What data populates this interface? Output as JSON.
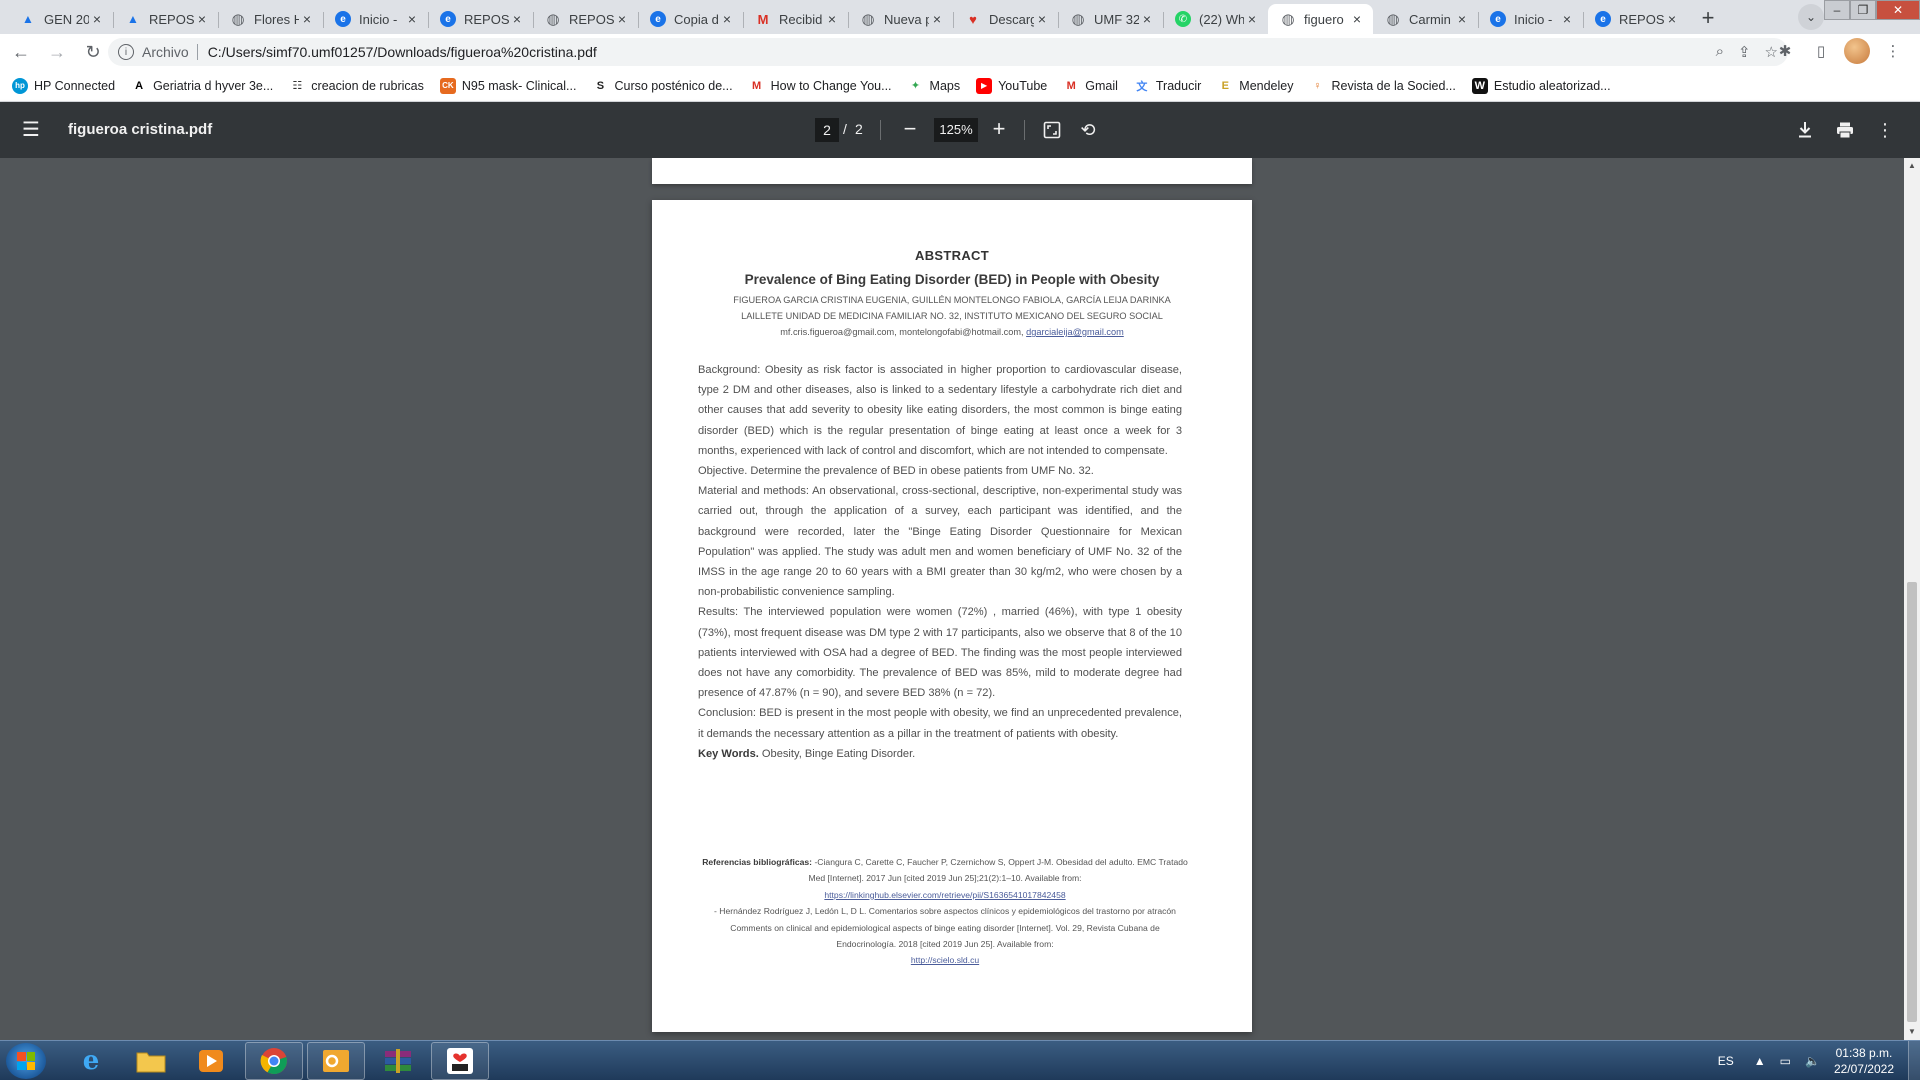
{
  "browser": {
    "tabs": [
      {
        "label": "GEN 20",
        "favicon": "drive",
        "color": "#1a73e8"
      },
      {
        "label": "REPOSI",
        "favicon": "drive",
        "color": "#1a73e8"
      },
      {
        "label": "Flores H",
        "favicon": "globe",
        "color": "#5f6368"
      },
      {
        "label": "Inicio -",
        "favicon": "edge-e",
        "color": "#1a73e8"
      },
      {
        "label": "REPOSI",
        "favicon": "edge-e",
        "color": "#1a73e8"
      },
      {
        "label": "REPOSI",
        "favicon": "globe",
        "color": "#5f6368"
      },
      {
        "label": "Copia d",
        "favicon": "edge-e",
        "color": "#1a73e8"
      },
      {
        "label": "Recibid",
        "favicon": "gmail",
        "color": "#d93025"
      },
      {
        "label": "Nueva p",
        "favicon": "globe",
        "color": "#5f6368"
      },
      {
        "label": "Descarg",
        "favicon": "heart",
        "color": "#d93025"
      },
      {
        "label": "UMF 32",
        "favicon": "globe",
        "color": "#5f6368"
      },
      {
        "label": "(22) Wh",
        "favicon": "whatsapp",
        "color": "#25d366"
      },
      {
        "label": "figuero",
        "favicon": "globe",
        "color": "#5f6368",
        "active": true
      },
      {
        "label": "Carmin",
        "favicon": "globe",
        "color": "#5f6368"
      },
      {
        "label": "Inicio -",
        "favicon": "edge-e",
        "color": "#1a73e8"
      },
      {
        "label": "REPOSI",
        "favicon": "edge-e",
        "color": "#1a73e8"
      }
    ],
    "address": {
      "chip": "Archivo",
      "url": "C:/Users/simf70.umf01257/Downloads/figueroa%20cristina.pdf"
    },
    "bookmarks": [
      {
        "label": "HP Connected",
        "icon": "hp-icon",
        "icon_color": "#0096d6"
      },
      {
        "label": "Geriatria d hyver 3e...",
        "icon": "a-icon",
        "icon_color": "#000000"
      },
      {
        "label": "creacion de rubricas",
        "icon": "rubric-icon",
        "icon_color": "#333333"
      },
      {
        "label": "N95 mask- Clinical...",
        "icon": "ck-icon",
        "icon_color": "#e66a1f"
      },
      {
        "label": "Curso posténico de...",
        "icon": "s-icon",
        "icon_color": "#222222"
      },
      {
        "label": "How to Change You...",
        "icon": "gmail-icon",
        "icon_color": "#d93025"
      },
      {
        "label": "Maps",
        "icon": "maps-icon",
        "icon_color": "#34a853"
      },
      {
        "label": "YouTube",
        "icon": "youtube-icon",
        "icon_color": "#ff0000"
      },
      {
        "label": "Gmail",
        "icon": "gmail-icon",
        "icon_color": "#d93025"
      },
      {
        "label": "Traducir",
        "icon": "translate-icon",
        "icon_color": "#4285f4"
      },
      {
        "label": "Mendeley",
        "icon": "mendeley-icon",
        "icon_color": "#c9a227"
      },
      {
        "label": "Revista de la Socied...",
        "icon": "figure-icon",
        "icon_color": "#e37a2c"
      },
      {
        "label": "Estudio aleatorizad...",
        "icon": "w-icon",
        "icon_color": "#111111"
      }
    ]
  },
  "pdf_viewer": {
    "title": "figueroa cristina.pdf",
    "current_page": "2",
    "page_separator": "/",
    "total_pages": "2",
    "zoom": "125%"
  },
  "document": {
    "heading": "ABSTRACT",
    "title": "Prevalence of Bing Eating Disorder (BED) in People with Obesity",
    "authors_line1": "FIGUEROA GARCIA CRISTINA EUGENIA, GUILLÉN MONTELONGO FABIOLA, GARCÍA LEIJA DARINKA",
    "authors_line2": "LAILLETE UNIDAD DE MEDICINA FAMILIAR NO. 32, INSTITUTO MEXICANO DEL SEGURO SOCIAL",
    "emails": "mf.cris.figueroa@gmail.com, montelongofabi@hotmail.com,",
    "email_link": "dgarcialeija@gmail.com",
    "background": "Background: Obesity as risk factor is associated in higher proportion to cardiovascular disease, type 2 DM and other diseases, also is linked to a sedentary lifestyle a carbohydrate rich diet and other causes that add severity to obesity like eating disorders, the most common is binge eating disorder (BED) which is the regular presentation of binge eating at least once a week for 3 months, experienced with lack of control and discomfort, which are not intended to compensate.",
    "objective": "Objective. Determine the prevalence of BED in obese patients from UMF No. 32.",
    "methods": "Material and methods: An observational, cross-sectional, descriptive, non-experimental study was carried out, through the application of a survey, each participant was identified, and the background were recorded, later the \"Binge Eating Disorder Questionnaire for Mexican Population\" was applied. The study was adult men and women beneficiary of UMF No. 32 of the IMSS in the age range 20 to 60 years with a BMI greater than 30 kg/m2, who were chosen by a non-probabilistic convenience sampling.",
    "results": "Results: The interviewed population were women (72%) , married (46%), with type 1 obesity (73%), most frequent disease was DM type 2 with 17 participants, also we observe that 8 of the 10 patients interviewed with OSA had a degree of BED. The finding was the most people interviewed does not have any comorbidity. The prevalence of BED was 85%, mild to moderate degree had presence of 47.87% (n = 90), and severe BED 38% (n = 72).",
    "conclusion": "Conclusion: BED is present in the most people with obesity, we find an unprecedented prevalence, it demands the necessary attention as a pillar in the treatment of patients with obesity.",
    "keywords_label": "Key Words.",
    "keywords": "Obesity, Binge Eating Disorder.",
    "refs_label": "Referencias bibliográficas:",
    "ref1": "-Ciangura C, Carette C, Faucher P, Czernichow S, Oppert J-M. Obesidad del adulto. EMC Tratado Med [Internet]. 2017 Jun [cited 2019 Jun 25];21(2):1–10. Available from:",
    "ref1_link": "https://linkinghub.elsevier.com/retrieve/pii/S1636541017842458",
    "ref2": "- Hernández Rodríguez J, Ledón L, D L. Comentarios sobre aspectos clínicos y epidemiológicos del trastorno por atracón Comments on clinical and epidemiological aspects of binge eating disorder [Internet]. Vol. 29, Revista Cubana de Endocrinología. 2018 [cited 2019 Jun 25]. Available from:",
    "ref2_link": "http://scielo.sld.cu"
  },
  "taskbar": {
    "language": "ES",
    "time": "01:38 p.m.",
    "date": "22/07/2022"
  }
}
